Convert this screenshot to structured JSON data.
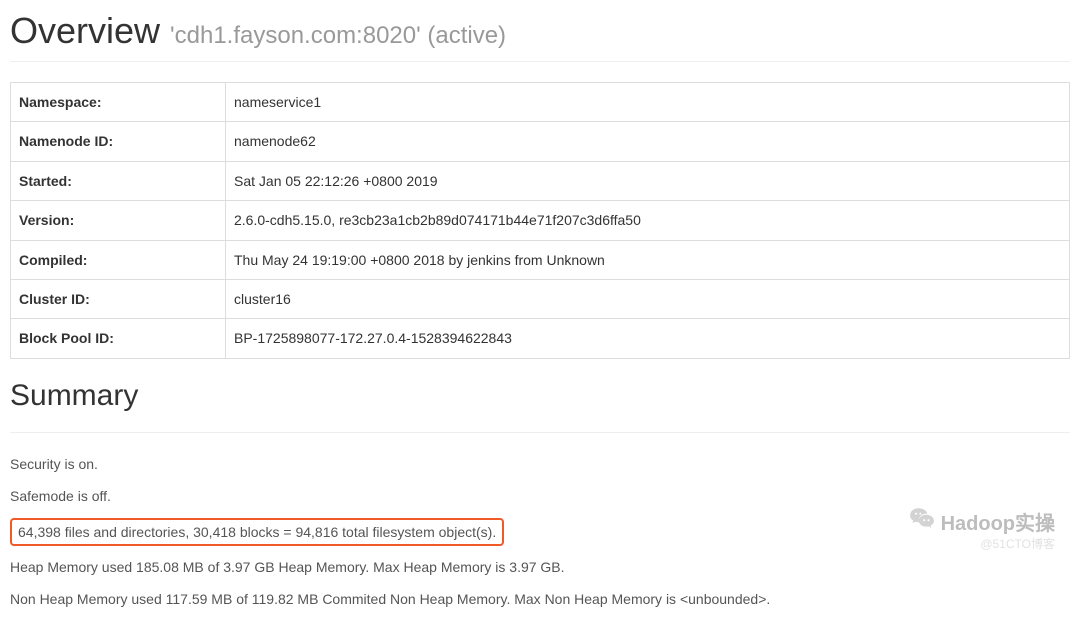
{
  "header": {
    "title": "Overview",
    "subtitle": "'cdh1.fayson.com:8020' (active)"
  },
  "overview_table": [
    {
      "label": "Namespace:",
      "value": "nameservice1"
    },
    {
      "label": "Namenode ID:",
      "value": "namenode62"
    },
    {
      "label": "Started:",
      "value": "Sat Jan 05 22:12:26 +0800 2019"
    },
    {
      "label": "Version:",
      "value": "2.6.0-cdh5.15.0, re3cb23a1cb2b89d074171b44e71f207c3d6ffa50"
    },
    {
      "label": "Compiled:",
      "value": "Thu May 24 19:19:00 +0800 2018 by jenkins from Unknown"
    },
    {
      "label": "Cluster ID:",
      "value": "cluster16"
    },
    {
      "label": "Block Pool ID:",
      "value": "BP-1725898077-172.27.0.4-1528394622843"
    }
  ],
  "summary": {
    "heading": "Summary",
    "security": "Security is on.",
    "safemode": "Safemode is off.",
    "fs_objects": "64,398 files and directories, 30,418 blocks = 94,816 total filesystem object(s).",
    "heap": "Heap Memory used 185.08 MB of 3.97 GB Heap Memory. Max Heap Memory is 3.97 GB.",
    "nonheap": "Non Heap Memory used 117.59 MB of 119.82 MB Commited Non Heap Memory. Max Non Heap Memory is <unbounded>."
  },
  "watermark": {
    "logo_text": "Hadoop实操",
    "sub_text": "@51CTO博客"
  }
}
